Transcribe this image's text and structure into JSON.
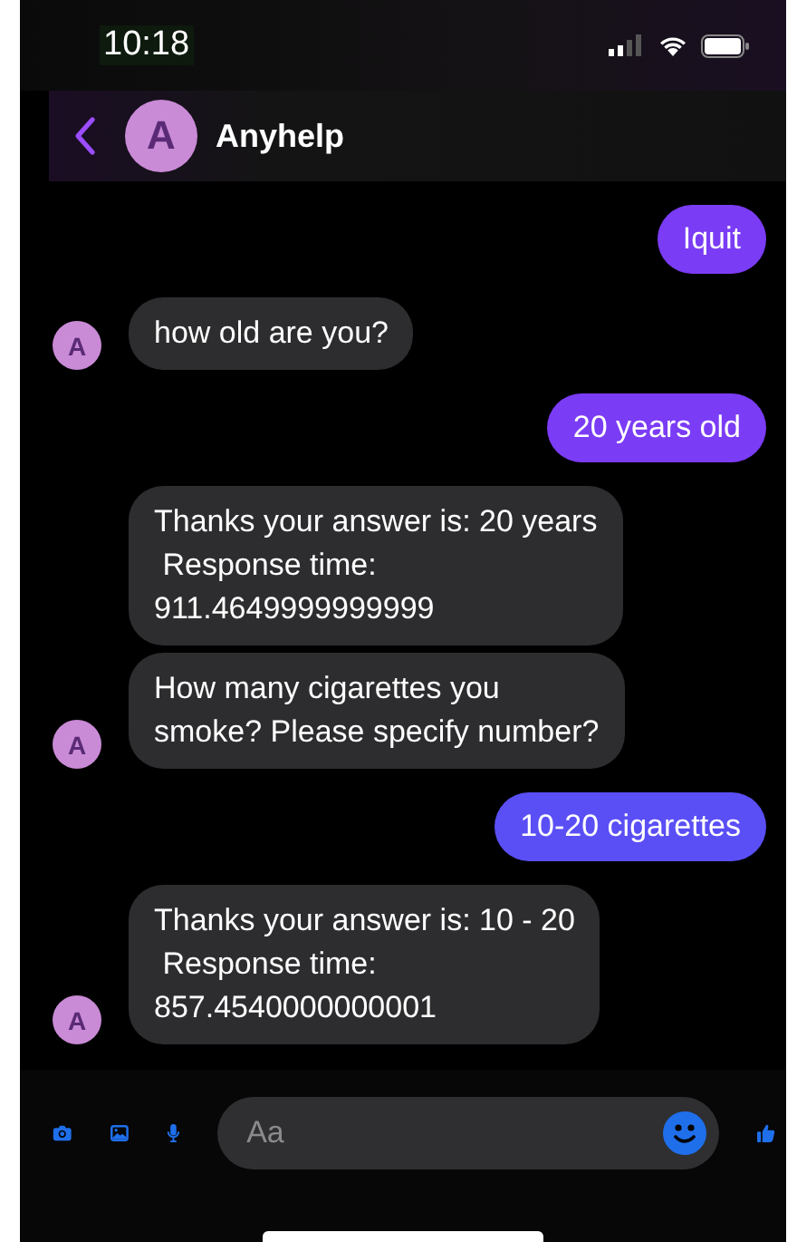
{
  "status_bar": {
    "time": "10:18"
  },
  "header": {
    "avatar": "A",
    "title": "Anyhelp"
  },
  "messages": [
    {
      "kind": "sent",
      "text": "Iquit"
    },
    {
      "kind": "received",
      "text": "how old are you?",
      "avatar": "A"
    },
    {
      "kind": "sent",
      "text": "20 years old"
    },
    {
      "kind": "received",
      "text": "Thanks your answer is: 20 years\n Response time:\n911.4649999999999"
    },
    {
      "kind": "received",
      "text": "How many cigarettes you\nsmoke? Please specify number?",
      "avatar": "A"
    },
    {
      "kind": "sent",
      "text": "10-20 cigarettes"
    },
    {
      "kind": "received",
      "text": "Thanks your answer is: 10 - 20\n Response time:\n857.4540000000001",
      "avatar": "A"
    }
  ],
  "composer": {
    "placeholder": "Aa"
  }
}
